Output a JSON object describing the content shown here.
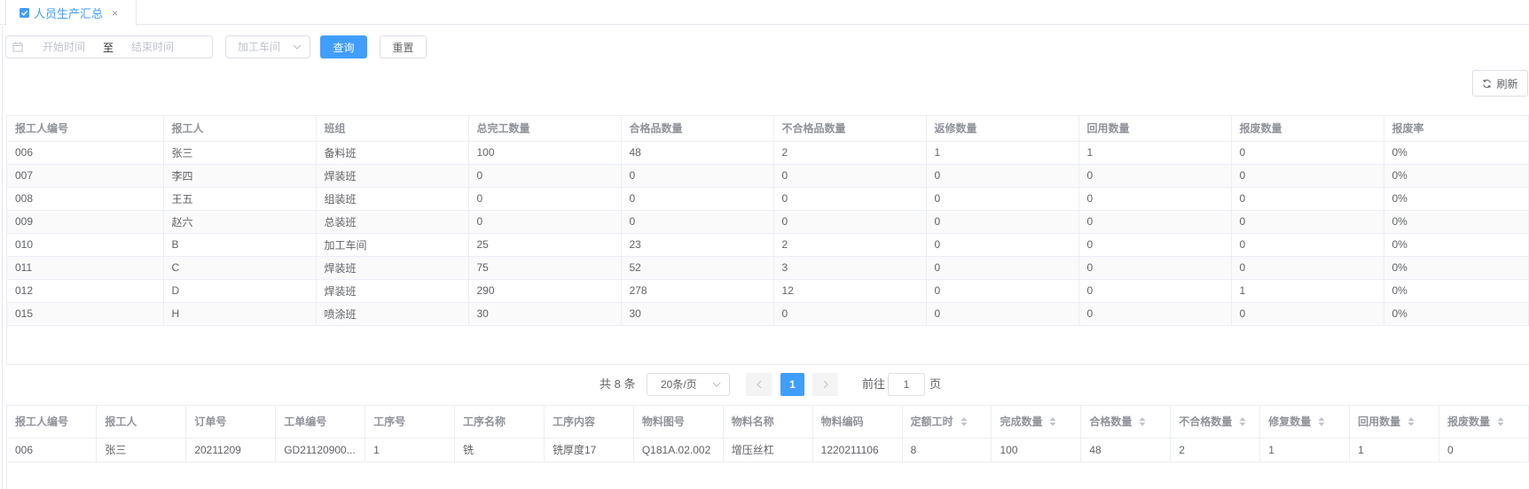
{
  "tab": {
    "label": "人员生产汇总",
    "close": "×"
  },
  "filters": {
    "start_placeholder": "开始时间",
    "separator": "至",
    "end_placeholder": "结束时间",
    "workshop_placeholder": "加工车间",
    "query_label": "查询",
    "reset_label": "重置"
  },
  "toolbar": {
    "refresh_label": "刷新"
  },
  "summary_table": {
    "headers": [
      "报工人编号",
      "报工人",
      "班组",
      "总完工数量",
      "合格品数量",
      "不合格品数量",
      "返修数量",
      "回用数量",
      "报废数量",
      "报废率"
    ],
    "rows": [
      [
        "006",
        "张三",
        "备料班",
        "100",
        "48",
        "2",
        "1",
        "1",
        "0",
        "0%"
      ],
      [
        "007",
        "李四",
        "焊装班",
        "0",
        "0",
        "0",
        "0",
        "0",
        "0",
        "0%"
      ],
      [
        "008",
        "王五",
        "组装班",
        "0",
        "0",
        "0",
        "0",
        "0",
        "0",
        "0%"
      ],
      [
        "009",
        "赵六",
        "总装班",
        "0",
        "0",
        "0",
        "0",
        "0",
        "0",
        "0%"
      ],
      [
        "010",
        "B",
        "加工车间",
        "25",
        "23",
        "2",
        "0",
        "0",
        "0",
        "0%"
      ],
      [
        "011",
        "C",
        "焊装班",
        "75",
        "52",
        "3",
        "0",
        "0",
        "0",
        "0%"
      ],
      [
        "012",
        "D",
        "焊装班",
        "290",
        "278",
        "12",
        "0",
        "0",
        "1",
        "0%"
      ],
      [
        "015",
        "H",
        "喷涂班",
        "30",
        "30",
        "0",
        "0",
        "0",
        "0",
        "0%"
      ]
    ]
  },
  "pagination": {
    "total_text": "共 8 条",
    "page_size": "20条/页",
    "current_page": "1",
    "goto_label": "前往",
    "goto_value": "1",
    "page_suffix": "页"
  },
  "detail_table": {
    "headers": [
      "报工人编号",
      "报工人",
      "订单号",
      "工单编号",
      "工序号",
      "工序名称",
      "工序内容",
      "物料图号",
      "物料名称",
      "物料编码",
      "定额工时",
      "完成数量",
      "合格数量",
      "不合格数量",
      "修复数量",
      "回用数量",
      "报废数量"
    ],
    "rows": [
      [
        "006",
        "张三",
        "20211209",
        "GD21120900...",
        "1",
        "铣",
        "铣厚度17",
        "Q181A.02.002",
        "增压丝杠",
        "1220211106",
        "8",
        "100",
        "48",
        "2",
        "1",
        "1",
        "0"
      ]
    ]
  },
  "icons": {
    "tab": "checkbox-icon",
    "close": "close-icon",
    "date": "calendar-icon",
    "select": "chevron-down-icon",
    "refresh": "refresh-icon",
    "prev": "chevron-left-icon",
    "next": "chevron-right-icon",
    "sort": "sort-caret-icon"
  },
  "colors": {
    "primary": "#409eff",
    "text": "#606266",
    "header_text": "#909399",
    "placeholder": "#c0c4cc",
    "border": "#dcdfe6",
    "stripe": "#fafafa"
  }
}
